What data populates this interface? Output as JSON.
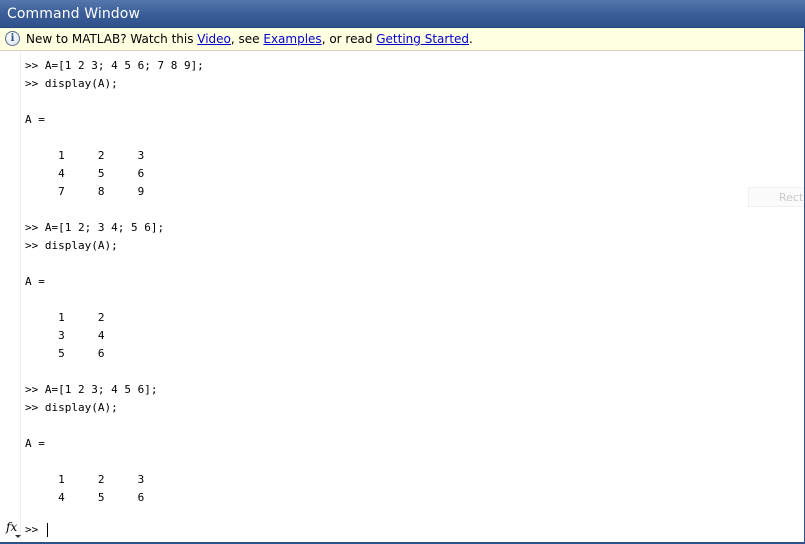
{
  "window": {
    "title": "Command Window"
  },
  "infobar": {
    "icon": "info-icon",
    "text_before": "New to MATLAB? Watch this ",
    "link_video": "Video",
    "text_mid1": ", see ",
    "link_examples": "Examples",
    "text_mid2": ", or read ",
    "link_getting_started": "Getting Started",
    "text_after": "."
  },
  "console": {
    "text": ">> A=[1 2 3; 4 5 6; 7 8 9];\n>> display(A);\n\nA =\n\n     1     2     3\n     4     5     6\n     7     8     9\n\n>> A=[1 2; 3 4; 5 6];\n>> display(A);\n\nA =\n\n     1     2\n     3     4\n     5     6\n\n>> A=[1 2 3; 4 5 6];\n>> display(A);\n\nA =\n\n     1     2     3\n     4     5     6"
  },
  "prompt": {
    "symbol": ">> ",
    "fx_icon": "function-browser-icon",
    "fx_label": "fx"
  },
  "ghost_tip": {
    "text": "Recta"
  }
}
